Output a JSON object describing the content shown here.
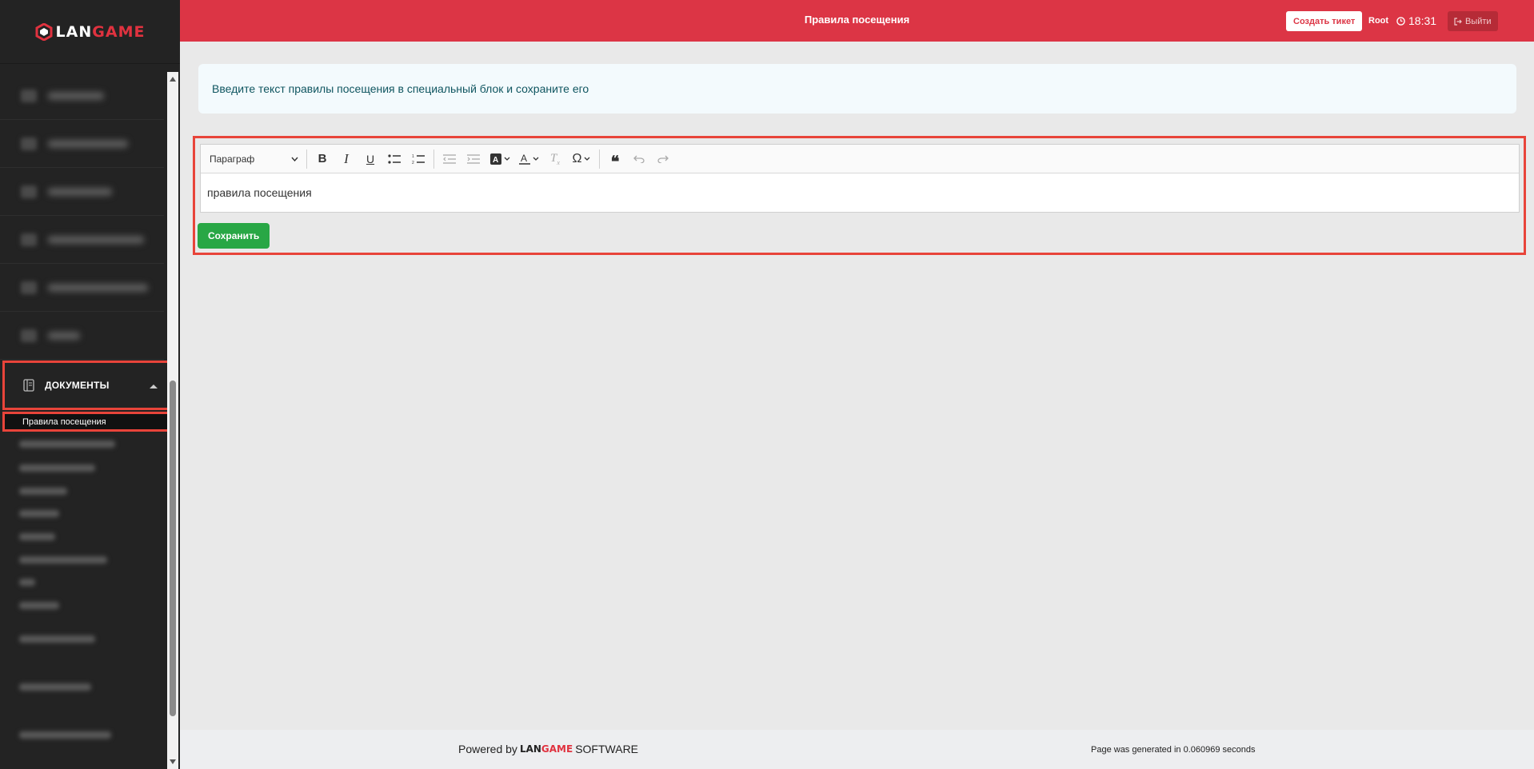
{
  "brand": {
    "logo_part1": "LAN",
    "logo_part2": "GAME",
    "accent_color": "#dc3545"
  },
  "header": {
    "title": "Правила посещения",
    "create_ticket_label": "Создать тикет",
    "user": "Root",
    "time": "18:31",
    "logout_label": "Выйти"
  },
  "sidebar": {
    "section_documents": "ДОКУМЕНТЫ",
    "active_subitem": "Правила посещения"
  },
  "alert": {
    "text": "Введите текст правилы посещения в специальный блок и сохраните его"
  },
  "editor": {
    "paragraph_style": "Параграф",
    "content": "правила посещения",
    "tools": [
      "bold-icon",
      "italic-icon",
      "underline-icon",
      "bulleted-list-icon",
      "numbered-list-icon",
      "outdent-icon",
      "indent-icon",
      "highlight-icon",
      "font-color-icon",
      "remove-format-icon",
      "special-chars-icon",
      "blockquote-icon",
      "undo-icon",
      "redo-icon"
    ]
  },
  "save_label": "Сохранить",
  "footer": {
    "powered_prefix": "Powered by",
    "brand_part1": "LAN",
    "brand_part2": "GAME",
    "brand_suffix": "SOFTWARE",
    "generated": "Page was generated in 0.060969 seconds"
  }
}
